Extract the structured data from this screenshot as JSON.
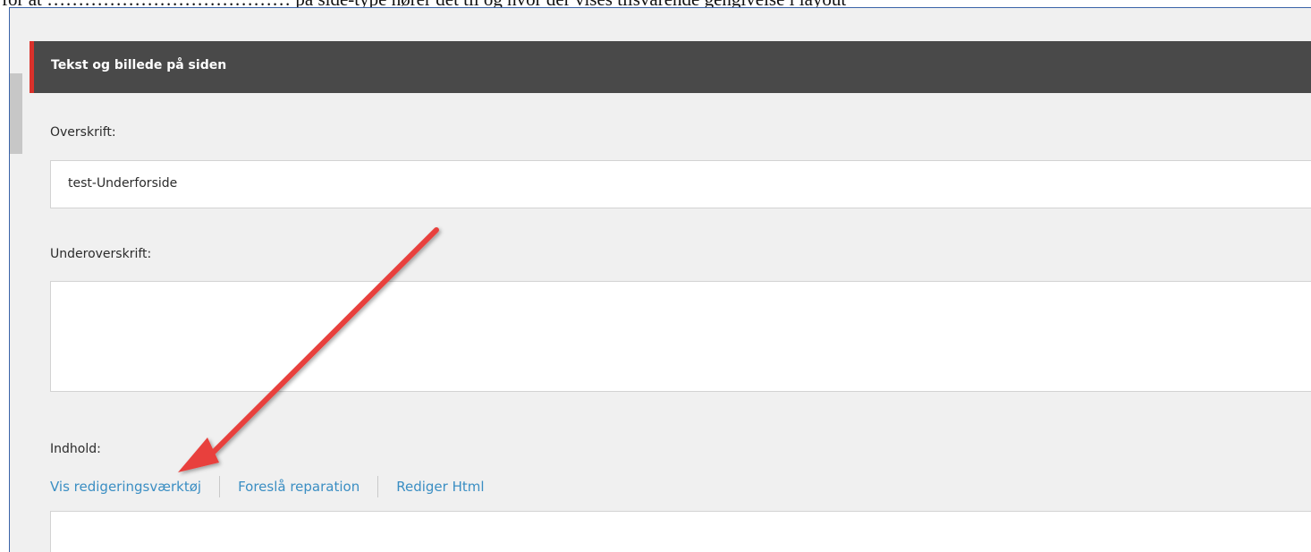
{
  "document": {
    "text_line": "for at ………………………………… på side-type hører det til og hvor der vises tilsvarende gengivelse i layout"
  },
  "section": {
    "title": "Tekst og billede på siden"
  },
  "fields": {
    "heading_label": "Overskrift:",
    "heading_value": "test-Underforside",
    "subheading_label": "Underoverskrift:",
    "subheading_value": "",
    "content_label": "Indhold:"
  },
  "content_links": {
    "show_editor": "Vis redigeringsværktøj",
    "suggest_repair": "Foreslå reparation",
    "edit_html": "Rediger Html"
  },
  "colors": {
    "header_bg": "#494949",
    "header_accent": "#d9312b",
    "link": "#3a8ec3",
    "arrow": "#e8413c"
  },
  "icons": {
    "annotation": "arrow-icon"
  }
}
